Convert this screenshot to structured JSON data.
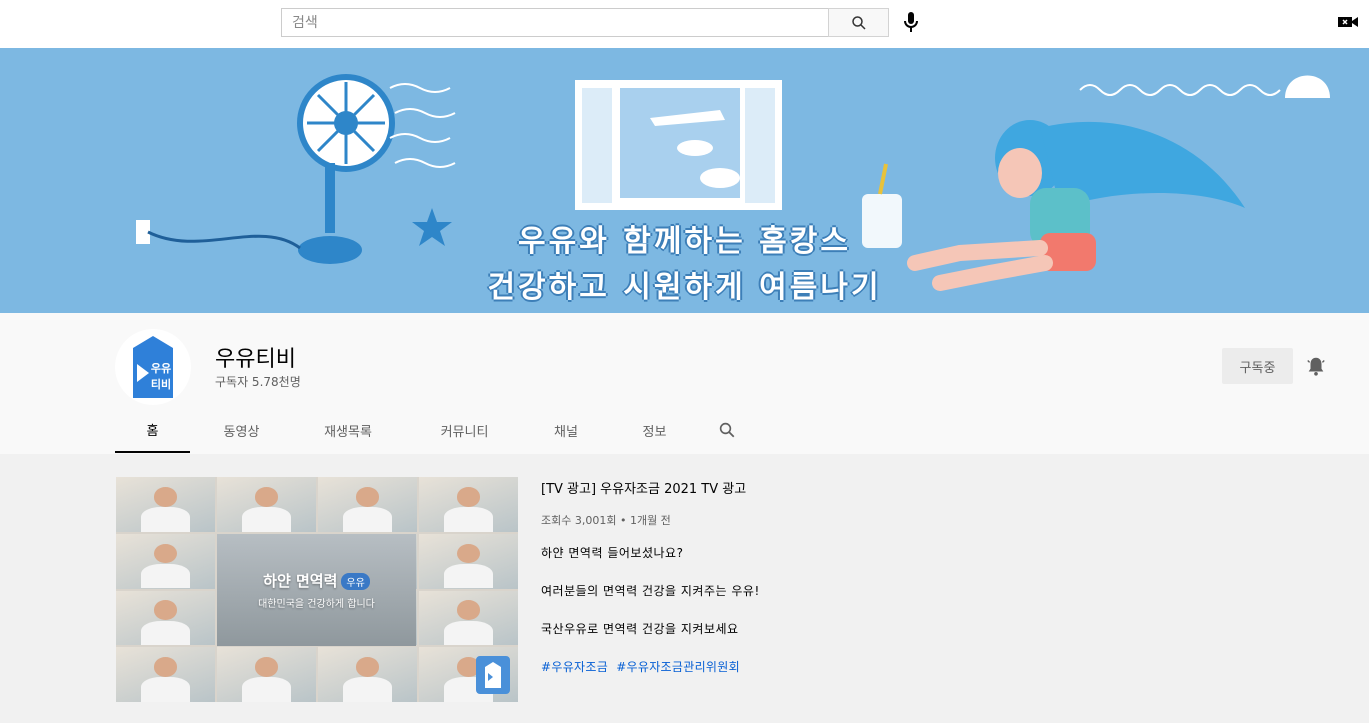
{
  "search": {
    "placeholder": "검색"
  },
  "banner": {
    "line1": "우유와 함께하는 홈캉스",
    "line2": "건강하고 시원하게 여름나기"
  },
  "channel": {
    "avatar_text": "우유\n티비",
    "name": "우유티비",
    "subscribers": "구독자 5.78천명",
    "subscribe_label": "구독중"
  },
  "tabs": [
    "홈",
    "동영상",
    "재생목록",
    "커뮤니티",
    "채널",
    "정보"
  ],
  "featured": {
    "thumbnail_big": "하얀 면역력",
    "thumbnail_tag": "우유",
    "thumbnail_small": "대한민국을 건강하게 합니다",
    "title": "[TV 광고] 우유자조금 2021 TV 광고",
    "meta": "조회수 3,001회 • 1개월 전",
    "desc1": "하얀 면역력 들어보셨나요?",
    "desc2": "여러분들의 면역력 건강을 지켜주는 우유!",
    "desc3": "국산우유로 면역력 건강을 지켜보세요",
    "hashtags": [
      "#우유자조금",
      "#우유자조금관리위원회"
    ]
  },
  "colors": {
    "banner": "#7db8e2",
    "link": "#065fd4"
  }
}
